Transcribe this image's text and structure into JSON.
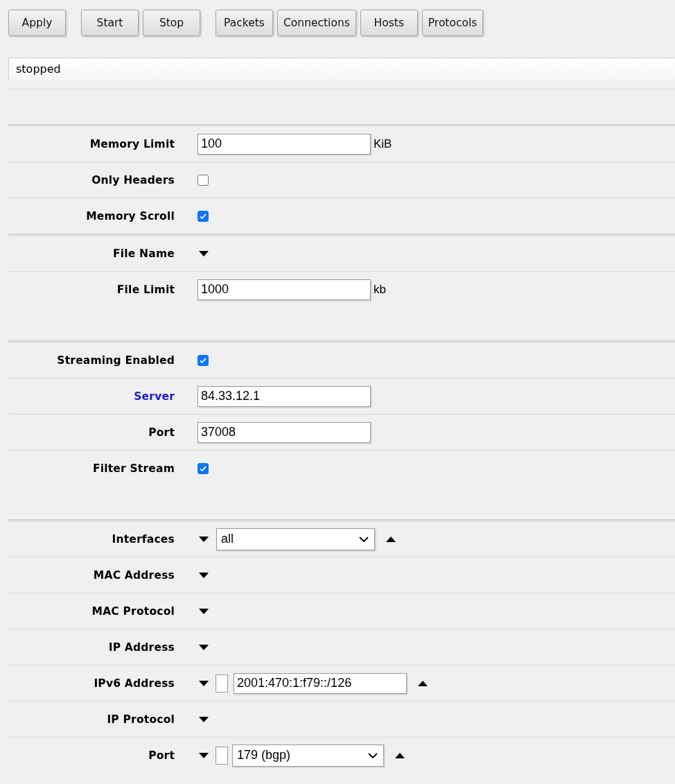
{
  "toolbar": [
    {
      "buttons": [
        "Apply"
      ]
    },
    {
      "buttons": [
        "Start",
        "Stop"
      ]
    },
    {
      "buttons": [
        "Packets",
        "Connections",
        "Hosts",
        "Protocols"
      ]
    }
  ],
  "status": "stopped",
  "sections": [
    {
      "rows": [
        {
          "kind": "text",
          "label": "Memory Limit",
          "link": false,
          "value": "100",
          "unit": "KiB"
        },
        {
          "kind": "checkbox",
          "label": "Only Headers",
          "link": false,
          "checked": false
        },
        {
          "kind": "checkbox",
          "label": "Memory Scroll",
          "link": false,
          "checked": true
        }
      ]
    },
    {
      "rows": [
        {
          "kind": "collapsed",
          "label": "File Name",
          "link": false
        },
        {
          "kind": "text",
          "label": "File Limit",
          "link": false,
          "value": "1000",
          "unit": "kb"
        }
      ]
    },
    {
      "rows": [
        {
          "kind": "checkbox",
          "label": "Streaming Enabled",
          "link": false,
          "checked": true
        },
        {
          "kind": "text",
          "label": "Server",
          "link": true,
          "value": "84.33.12.1"
        },
        {
          "kind": "text",
          "label": "Port",
          "link": false,
          "value": "37008"
        },
        {
          "kind": "checkbox",
          "label": "Filter Stream",
          "link": false,
          "checked": true
        }
      ]
    },
    {
      "rows": [
        {
          "kind": "select",
          "label": "Interfaces",
          "link": false,
          "value": "all"
        },
        {
          "kind": "collapsed",
          "label": "MAC Address",
          "link": false
        },
        {
          "kind": "collapsed",
          "label": "MAC Protocol",
          "link": false
        },
        {
          "kind": "collapsed",
          "label": "IP Address",
          "link": false
        },
        {
          "kind": "negated-text",
          "label": "IPv6 Address",
          "link": false,
          "negated": false,
          "value": "2001:470:1:f79::/126"
        },
        {
          "kind": "collapsed",
          "label": "IP Protocol",
          "link": false
        },
        {
          "kind": "negated-select",
          "label": "Port",
          "link": false,
          "negated": false,
          "value": "179 (bgp)"
        }
      ]
    }
  ]
}
